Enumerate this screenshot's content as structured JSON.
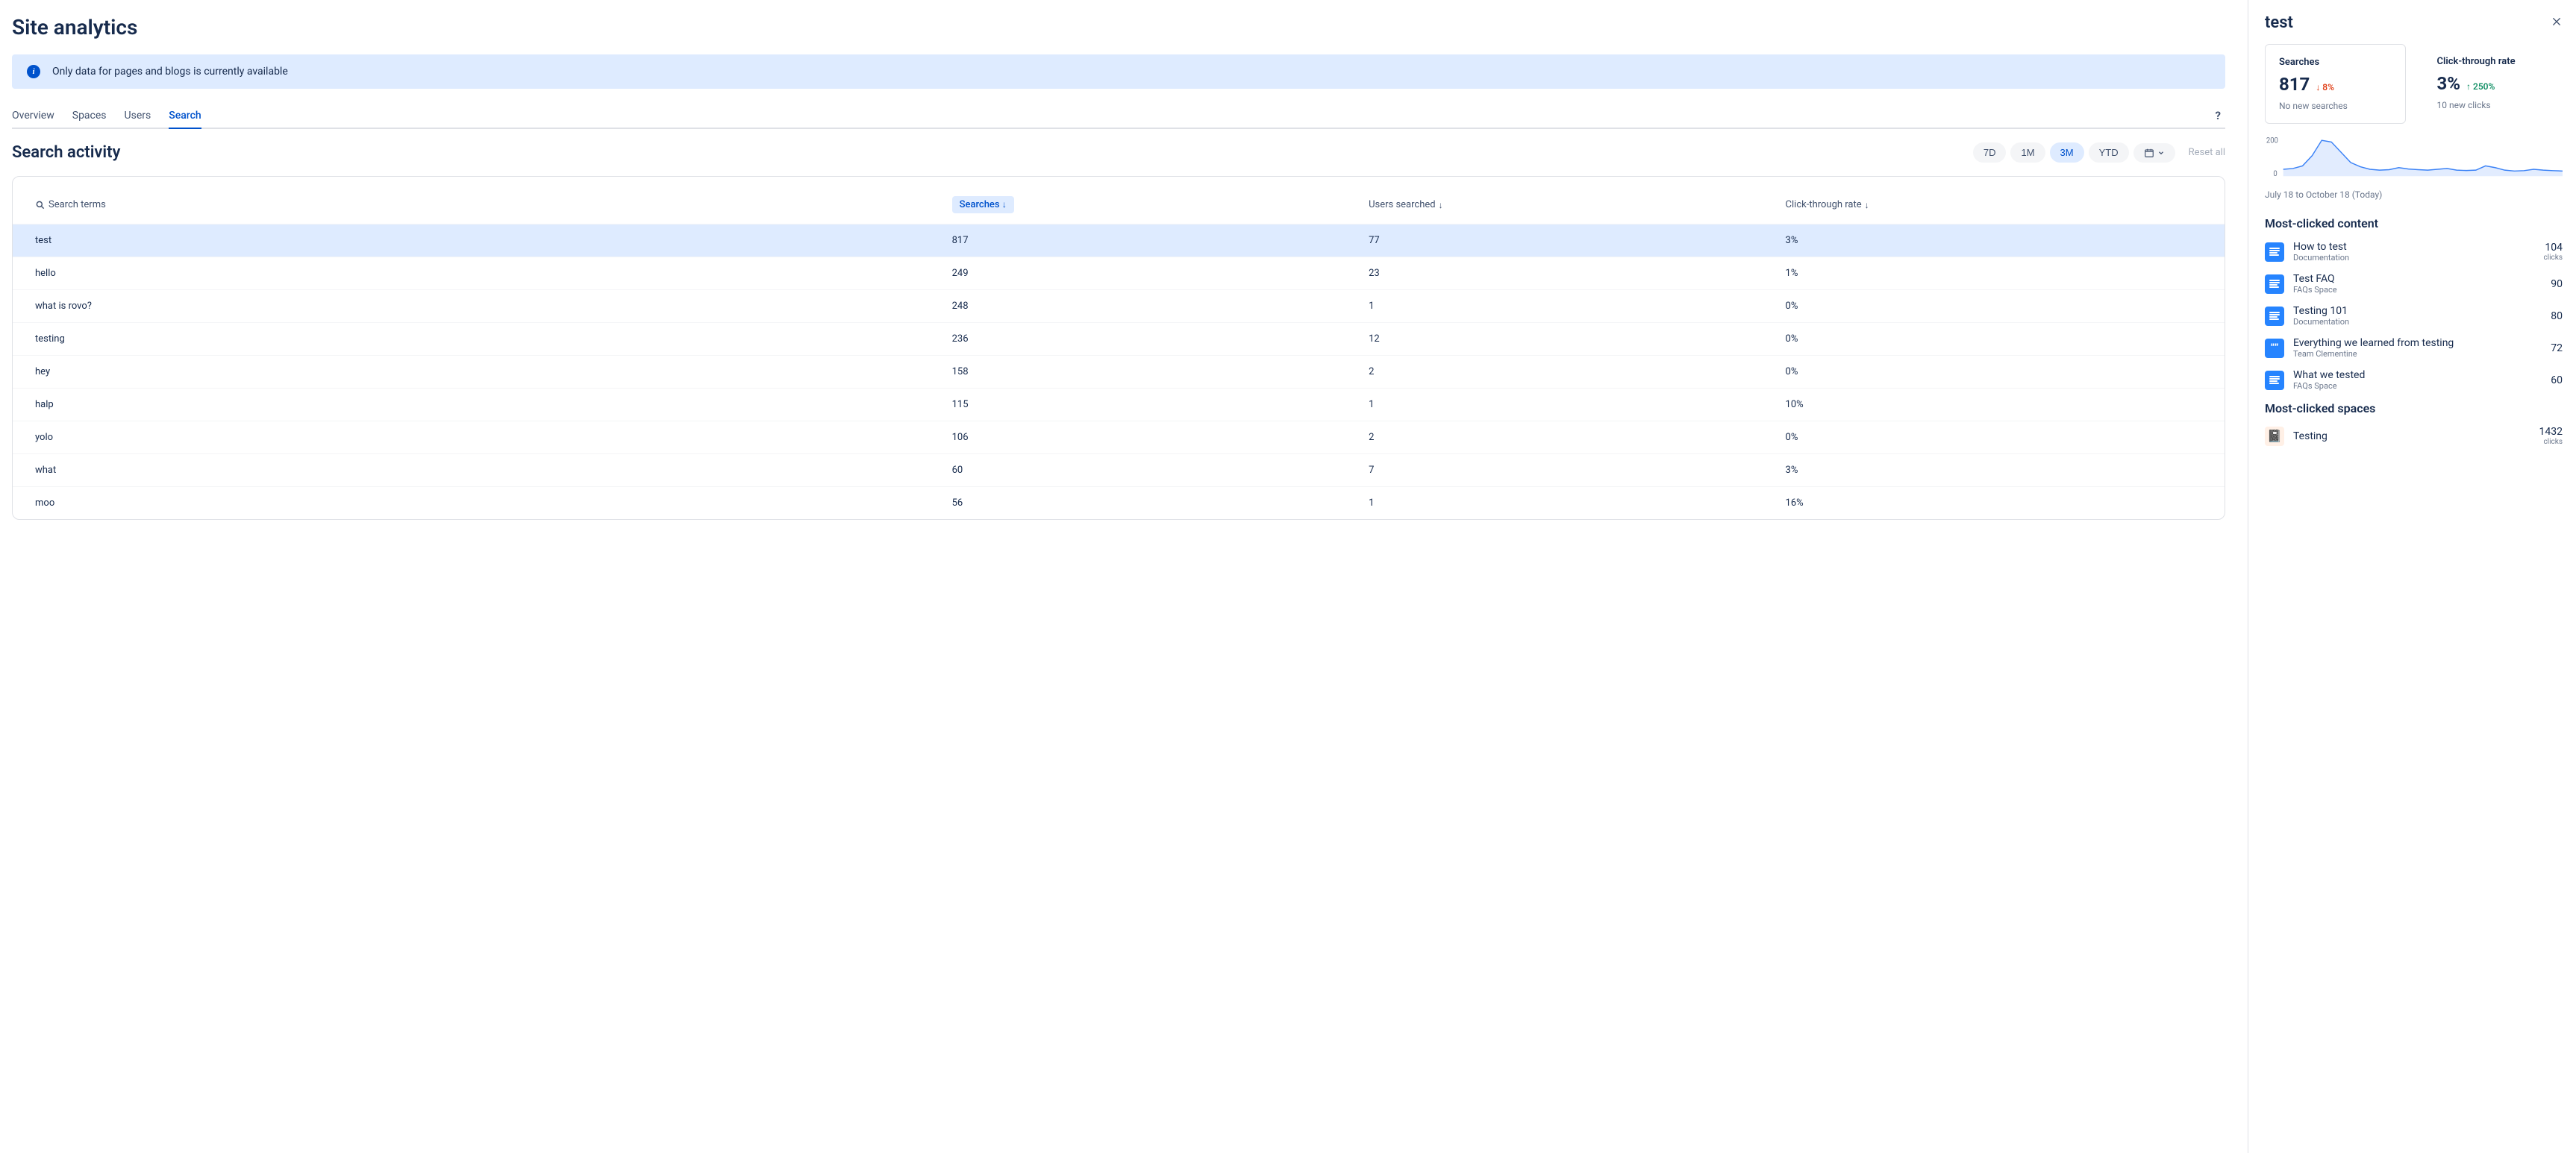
{
  "page_title": "Site analytics",
  "banner_text": "Only data for pages and blogs is currently available",
  "tabs": [
    "Overview",
    "Spaces",
    "Users",
    "Search"
  ],
  "active_tab": "Search",
  "section_title": "Search activity",
  "time_pills": [
    "7D",
    "1M",
    "3M",
    "YTD"
  ],
  "active_pill": "3M",
  "reset_label": "Reset all",
  "columns": {
    "c1": "Search terms",
    "c2": "Searches",
    "c3": "Users searched",
    "c4": "Click-through rate"
  },
  "rows": [
    {
      "term": "test",
      "searches": "817",
      "users": "77",
      "ctr": "3%",
      "selected": true
    },
    {
      "term": "hello",
      "searches": "249",
      "users": "23",
      "ctr": "1%"
    },
    {
      "term": "what is rovo?",
      "searches": "248",
      "users": "1",
      "ctr": "0%"
    },
    {
      "term": "testing",
      "searches": "236",
      "users": "12",
      "ctr": "0%"
    },
    {
      "term": "hey",
      "searches": "158",
      "users": "2",
      "ctr": "0%"
    },
    {
      "term": "halp",
      "searches": "115",
      "users": "1",
      "ctr": "10%"
    },
    {
      "term": "yolo",
      "searches": "106",
      "users": "2",
      "ctr": "0%"
    },
    {
      "term": "what",
      "searches": "60",
      "users": "7",
      "ctr": "3%"
    },
    {
      "term": "moo",
      "searches": "56",
      "users": "1",
      "ctr": "16%"
    }
  ],
  "side": {
    "title": "test",
    "searches": {
      "label": "Searches",
      "value": "817",
      "delta": "8%",
      "sub": "No new searches"
    },
    "ctr": {
      "label": "Click-through rate",
      "value": "3%",
      "delta": "250%",
      "sub": "10 new clicks"
    },
    "date_range": "July 18 to October 18 (Today)",
    "most_clicked_content_title": "Most-clicked content",
    "content": [
      {
        "title": "How to test",
        "space": "Documentation",
        "count": "104",
        "unit": "clicks",
        "icon": "doc"
      },
      {
        "title": "Test FAQ",
        "space": "FAQs Space",
        "count": "90",
        "unit": "",
        "icon": "doc"
      },
      {
        "title": "Testing 101",
        "space": "Documentation",
        "count": "80",
        "unit": "",
        "icon": "doc"
      },
      {
        "title": "Everything we learned from testing",
        "space": "Team Clementine",
        "count": "72",
        "unit": "",
        "icon": "quote"
      },
      {
        "title": "What we tested",
        "space": "FAQs Space",
        "count": "60",
        "unit": "",
        "icon": "doc"
      }
    ],
    "most_clicked_spaces_title": "Most-clicked spaces",
    "spaces": [
      {
        "title": "Testing",
        "count": "1432",
        "unit": "clicks",
        "emoji": "📓"
      }
    ]
  },
  "chart_data": {
    "type": "area",
    "title": "",
    "xlabel": "",
    "ylabel": "",
    "ylim": [
      0,
      220
    ],
    "y_ticks": [
      0,
      200
    ],
    "x_range": "July 18 to October 18",
    "series": [
      {
        "name": "Searches",
        "values": [
          40,
          45,
          60,
          120,
          210,
          200,
          140,
          80,
          55,
          40,
          35,
          38,
          50,
          42,
          38,
          35,
          40,
          45,
          35,
          33,
          35,
          60,
          50,
          35,
          30,
          32,
          40,
          35,
          32,
          30
        ]
      }
    ]
  }
}
